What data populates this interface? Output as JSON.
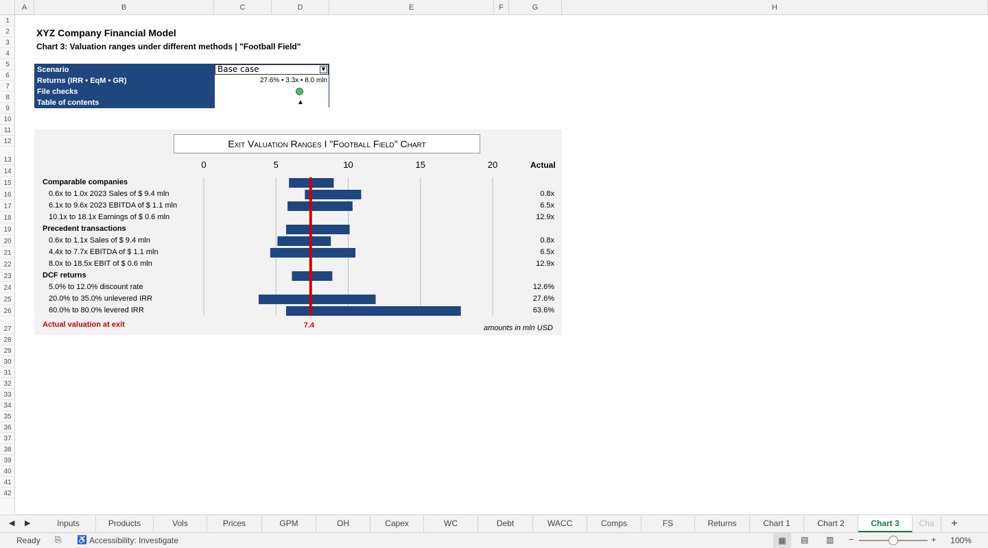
{
  "columns": [
    "A",
    "B",
    "C",
    "D",
    "E",
    "F",
    "G",
    "H"
  ],
  "rows": [
    "1",
    "2",
    "3",
    "4",
    "5",
    "6",
    "7",
    "8",
    "9",
    "10",
    "11",
    "12",
    "13",
    "14",
    "15",
    "16",
    "17",
    "18",
    "19",
    "20",
    "21",
    "22",
    "23",
    "24",
    "25",
    "26",
    "27",
    "28",
    "29",
    "30",
    "31",
    "32",
    "33",
    "34",
    "35",
    "36",
    "37",
    "38",
    "39",
    "40",
    "41",
    "42"
  ],
  "header": {
    "title": "XYZ Company Financial Model",
    "subtitle": "Chart 3: Valuation ranges under different methods | \"Football Field\""
  },
  "info": {
    "scenario_label": "Scenario",
    "scenario_value": "Base case",
    "returns_label": "Returns (IRR • EqM • GR)",
    "returns_value": "27.6% • 3.3x • 8.0 mln",
    "checks_label": "File checks",
    "toc_label": "Table of contents",
    "toc_icon": "▲",
    "check_color": "#2ecc71"
  },
  "chart_data": {
    "type": "bar",
    "title": "Exit Valuation Ranges I \"Football Field\" Chart",
    "x_ticks": [
      "0",
      "5",
      "10",
      "15",
      "20"
    ],
    "xlim": [
      0,
      20
    ],
    "actual_header": "Actual",
    "marker_label": "Actual valuation at exit",
    "marker_value": 7.4,
    "marker_value_text": "7.4",
    "units_note": "amounts in mln USD",
    "groups": [
      {
        "name": "Comparable companies",
        "low": 5.9,
        "high": 9.0,
        "rows": [
          {
            "label": "0.6x to 1.0x 2023 Sales of $ 9.4 mln",
            "low": 7.0,
            "high": 10.9,
            "actual": "0.8x"
          },
          {
            "label": "6.1x to 9.6x 2023 EBITDA of $ 1.1 mln",
            "low": 5.8,
            "high": 10.3,
            "actual": "6.5x"
          },
          {
            "label": "10.1x to 18.1x Earnings of $ 0.6 mln",
            "low": null,
            "high": null,
            "actual": "12.9x"
          }
        ]
      },
      {
        "name": "Precedent transactions",
        "low": 5.7,
        "high": 10.1,
        "rows": [
          {
            "label": "0.6x to 1.1x Sales of $ 9.4 mln",
            "low": 5.1,
            "high": 8.8,
            "actual": "0.8x"
          },
          {
            "label": "4.4x to 7.7x EBITDA of $ 1.1 mln",
            "low": 4.6,
            "high": 10.5,
            "actual": "6.5x"
          },
          {
            "label": "8.0x to 18.5x EBIT of $ 0.6 mln",
            "low": null,
            "high": null,
            "actual": "12.9x"
          }
        ]
      },
      {
        "name": "DCF returns",
        "low": 6.1,
        "high": 8.9,
        "rows": [
          {
            "label": "5.0% to 12.0% discount rate",
            "low": null,
            "high": null,
            "actual": "12.6%"
          },
          {
            "label": "20.0% to 35.0% unlevered IRR",
            "low": 3.8,
            "high": 11.9,
            "actual": "27.6%"
          },
          {
            "label": "60.0% to 80.0% levered IRR",
            "low": 5.7,
            "high": 17.8,
            "actual": "63.6%"
          }
        ]
      }
    ],
    "bar_color": "#1f467f",
    "marker_color": "#cc0000"
  },
  "tabs": [
    "Inputs",
    "Products",
    "Vols",
    "Prices",
    "GPM",
    "OH",
    "Capex",
    "WC",
    "Debt",
    "WACC",
    "Comps",
    "FS",
    "Returns",
    "Chart 1",
    "Chart 2",
    "Chart 3",
    "Cha"
  ],
  "active_tab": "Chart 3",
  "status": {
    "ready": "Ready",
    "accessibility": "Accessibility: Investigate",
    "zoom": "100%"
  }
}
